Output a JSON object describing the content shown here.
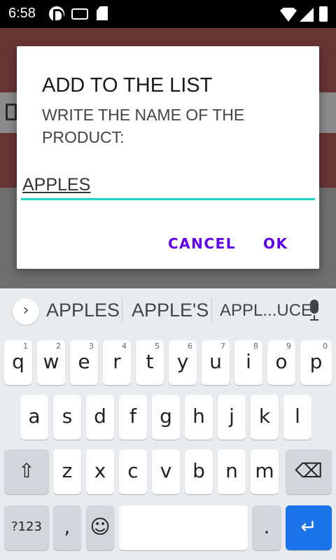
{
  "status_bar": {
    "time": "6:58",
    "icons": [
      "app-badge-icon",
      "keyboard-icon",
      "sdcard-icon",
      "wifi-icon",
      "signal-icon",
      "battery-icon"
    ]
  },
  "dialog": {
    "title": "ADD TO THE LIST",
    "message": "WRITE THE NAME OF THE PRODUCT:",
    "input_value": "APPLES",
    "cancel_label": "CANCEL",
    "ok_label": "OK",
    "accent_color": "#6200ee",
    "input_underline_color": "#1ed6c8"
  },
  "keyboard": {
    "expand_label": "›",
    "suggestions": [
      "APPLES",
      "APPLE'S",
      "APPL...UCE"
    ],
    "row1": [
      {
        "key": "q",
        "hint": "1"
      },
      {
        "key": "w",
        "hint": "2"
      },
      {
        "key": "e",
        "hint": "3"
      },
      {
        "key": "r",
        "hint": "4"
      },
      {
        "key": "t",
        "hint": "5"
      },
      {
        "key": "y",
        "hint": "6"
      },
      {
        "key": "u",
        "hint": "7"
      },
      {
        "key": "i",
        "hint": "8"
      },
      {
        "key": "o",
        "hint": "9"
      },
      {
        "key": "p",
        "hint": "0"
      }
    ],
    "row2": [
      "a",
      "s",
      "d",
      "f",
      "g",
      "h",
      "j",
      "k",
      "l"
    ],
    "row3": [
      "z",
      "x",
      "c",
      "v",
      "b",
      "n",
      "m"
    ],
    "shift_label": "⇧",
    "backspace_label": "⌫",
    "symbols_label": "?123",
    "comma_label": ",",
    "emoji_label": "☺",
    "space_label": "",
    "period_label": ".",
    "enter_label": "↵",
    "enter_color": "#1a73e8"
  }
}
